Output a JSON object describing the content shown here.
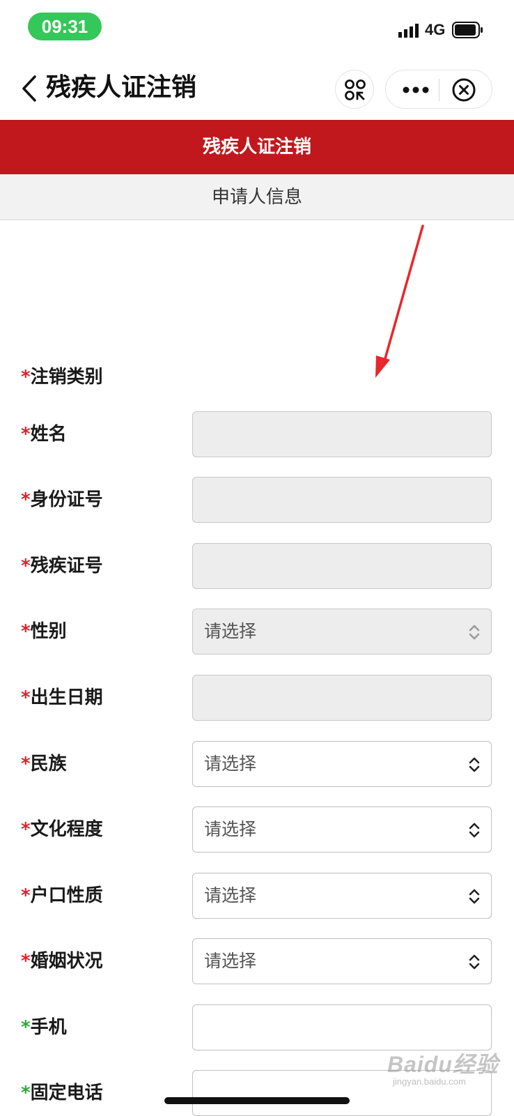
{
  "status_bar": {
    "time": "09:31",
    "network": "4G"
  },
  "nav": {
    "title": "残疾人证注销"
  },
  "banner": {
    "title": "残疾人证注销"
  },
  "section": {
    "title": "申请人信息"
  },
  "form": {
    "required_mark": "*",
    "cancel_type_label": "注销类别",
    "fields": [
      {
        "label": "姓名",
        "type": "text",
        "disabled": true,
        "value": ""
      },
      {
        "label": "身份证号",
        "type": "text",
        "disabled": true,
        "value": ""
      },
      {
        "label": "残疾证号",
        "type": "text",
        "disabled": true,
        "value": ""
      },
      {
        "label": "性别",
        "type": "select",
        "disabled": true,
        "value": "请选择"
      },
      {
        "label": "出生日期",
        "type": "text",
        "disabled": true,
        "value": ""
      },
      {
        "label": "民族",
        "type": "select",
        "disabled": false,
        "value": "请选择"
      },
      {
        "label": "文化程度",
        "type": "select",
        "disabled": false,
        "value": "请选择"
      },
      {
        "label": "户口性质",
        "type": "select",
        "disabled": false,
        "value": "请选择"
      },
      {
        "label": "婚姻状况",
        "type": "select",
        "disabled": false,
        "value": "请选择"
      },
      {
        "label": "手机",
        "type": "text",
        "disabled": false,
        "value": ""
      },
      {
        "label": "固定电话",
        "type": "text",
        "disabled": false,
        "value": ""
      }
    ]
  },
  "watermark": {
    "logo": "Baidu经验",
    "sub": "jingyan.baidu.com"
  },
  "colors": {
    "banner": "#c0181d",
    "required": "#d8262c",
    "required_optional": "#2fa83b",
    "time_pill": "#34c759",
    "annotation_arrow": "#e8262c"
  }
}
